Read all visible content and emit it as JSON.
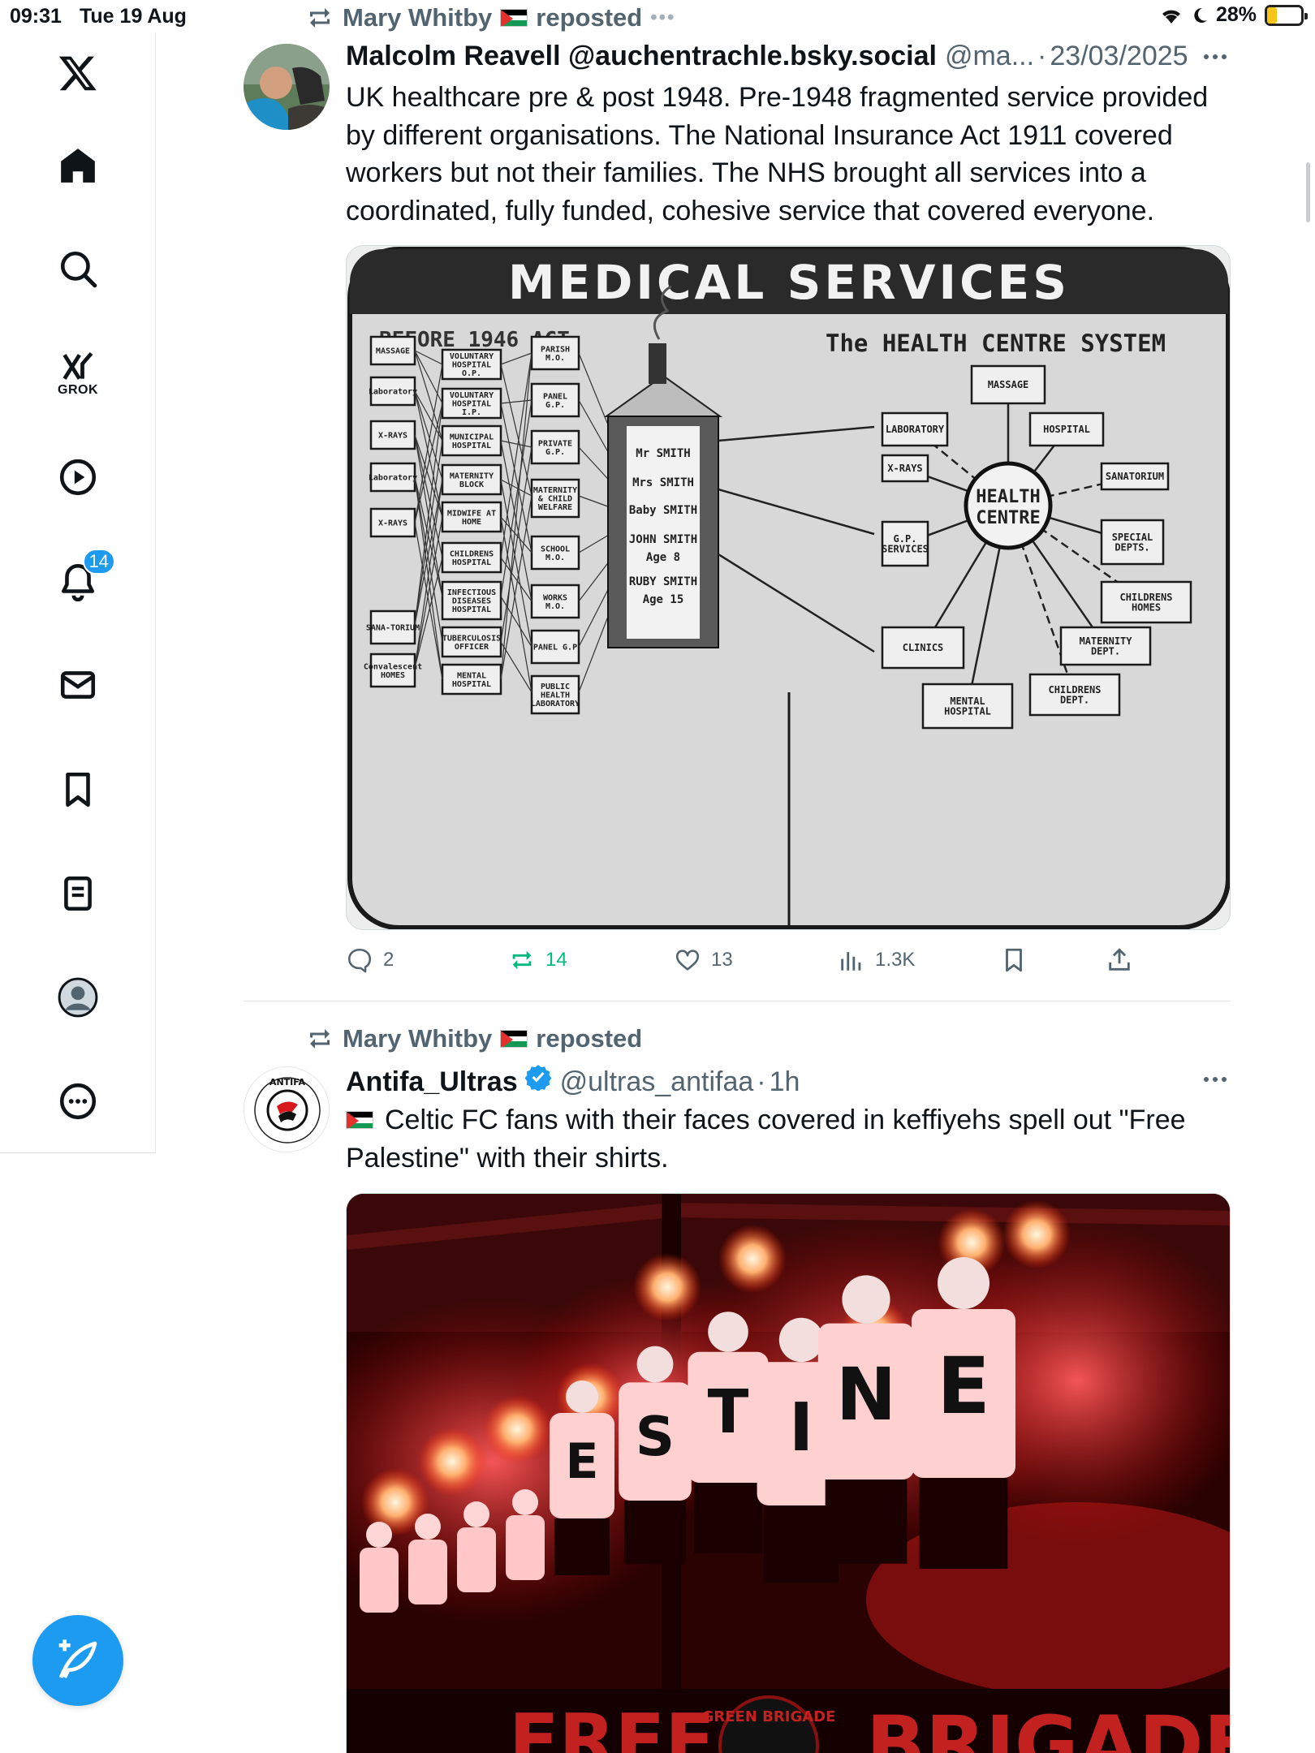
{
  "status_bar": {
    "time": "09:31",
    "date": "Tue 19 Aug",
    "battery": "28%",
    "battery_level": 0.28
  },
  "sidebar": {
    "items": [
      {
        "name": "x-logo",
        "icon": "x-logo-icon"
      },
      {
        "name": "home",
        "icon": "home-icon"
      },
      {
        "name": "explore",
        "icon": "search-icon"
      },
      {
        "name": "grok",
        "icon": "grok-icon",
        "label": "GROK"
      },
      {
        "name": "video",
        "icon": "play-icon"
      },
      {
        "name": "notifications",
        "icon": "bell-icon",
        "badge": "14"
      },
      {
        "name": "messages",
        "icon": "mail-icon"
      },
      {
        "name": "bookmarks",
        "icon": "bookmark-icon"
      },
      {
        "name": "lists",
        "icon": "list-icon"
      },
      {
        "name": "profile",
        "icon": "avatar-icon"
      },
      {
        "name": "more",
        "icon": "more-circle-icon"
      }
    ],
    "compose_icon": "compose-icon"
  },
  "posts": [
    {
      "repost_label": "Mary Whitby",
      "repost_suffix": "reposted",
      "author_name": "Malcolm Reavell @auchentrachle.bsky.social",
      "author_handle": "@ma...",
      "separator": "·",
      "timestamp": "23/03/2025",
      "text": "UK healthcare pre & post 1948. Pre-1948 fragmented service provided by different organisations. The National Insurance Act 1911 covered workers but not their families. The NHS brought all services into a coordinated, fully funded, cohesive service that covered everyone.",
      "image": {
        "title": "MEDICAL SERVICES",
        "left_heading": "BEFORE 1946 ACT",
        "right_heading": "The HEALTH CENTRE SYSTEM",
        "left_col1": [
          "MASSAGE",
          "Laboratory",
          "X-RAYS",
          "Laboratory",
          "X-RAYS",
          "SANA-TORIUM",
          "Convalescent HOMES"
        ],
        "left_col2": [
          "VOLUNTARY HOSPITAL O.P.",
          "VOLUNTARY HOSPITAL I.P.",
          "MUNICIPAL HOSPITAL",
          "MATERNITY BLOCK",
          "MIDWIFE AT HOME",
          "CHILDRENS HOSPITAL",
          "INFECTIOUS DISEASES HOSPITAL",
          "TUBERCULOSIS OFFICER",
          "MENTAL HOSPITAL"
        ],
        "left_col3": [
          "PARISH M.O.",
          "PANEL G.P.",
          "PRIVATE G.P.",
          "MATERNITY & CHILD WELFARE",
          "SCHOOL M.O.",
          "WORKS M.O.",
          "PANEL G.P",
          "PUBLIC HEALTH LABORATORY"
        ],
        "family": [
          "Mr SMITH",
          "Mrs SMITH",
          "Baby SMITH",
          "JOHN SMITH",
          "Age 8",
          "RUBY SMITH",
          "Age 15"
        ],
        "centre": [
          "HEALTH",
          "CENTRE"
        ],
        "spokes": [
          "MASSAGE",
          "LABORATORY",
          "HOSPITAL",
          "X-RAYS",
          "SANATORIUM",
          "G.P. SERVICES",
          "SPECIAL DEPTS.",
          "CHILDRENS HOMES",
          "CLINICS",
          "MATERNITY DEPT.",
          "CHILDRENS DEPT.",
          "MENTAL HOSPITAL"
        ]
      },
      "actions": {
        "replies": "2",
        "reposts": "14",
        "likes": "13",
        "views": "1.3K"
      }
    },
    {
      "repost_label": "Mary Whitby",
      "repost_suffix": "reposted",
      "author_name": "Antifa_Ultras",
      "author_handle": "@ultras_antifaa",
      "separator": "·",
      "timestamp": "1h",
      "text_line1": "Celtic FC fans with their faces covered in keffiyehs spell out \"Free",
      "text_line2": "Palestine\" with their shirts.",
      "avatar_text": "ANTIFA INTERNATIONAL",
      "image": {
        "shirt_letters": [
          "E",
          "S",
          "T",
          "I",
          "N",
          "E"
        ],
        "banner_left": "FREE",
        "banner_middle": "GREEN BRIGADE",
        "banner_right": "BRIGADE"
      }
    }
  ],
  "colors": {
    "accent": "#1d9bf0",
    "repost_green": "#00ba7c",
    "muted": "#536471",
    "text": "#0f1419"
  }
}
